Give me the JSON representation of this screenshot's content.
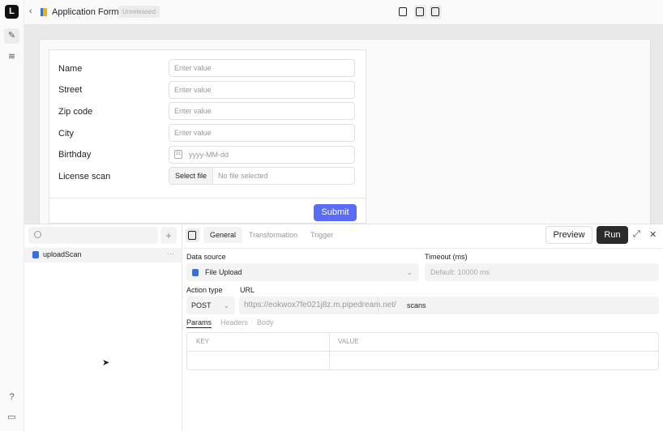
{
  "app": {
    "title": "Application Form",
    "status": "Unreleased"
  },
  "form": {
    "fields": [
      {
        "label": "Name",
        "placeholder": "Enter value"
      },
      {
        "label": "Street",
        "placeholder": "Enter value"
      },
      {
        "label": "Zip code",
        "placeholder": "Enter value"
      },
      {
        "label": "City",
        "placeholder": "Enter value"
      },
      {
        "label": "Birthday",
        "placeholder": "yyyy-MM-dd"
      },
      {
        "label": "License scan",
        "button": "Select file",
        "placeholder": "No file selected"
      }
    ],
    "submit": "Submit",
    "accent": "#5a6cf5"
  },
  "queries": {
    "items": [
      {
        "name": "uploadScan"
      }
    ],
    "more": "···",
    "add": "+"
  },
  "editor": {
    "tabs": [
      "General",
      "Transformation",
      "Trigger"
    ],
    "preview": "Preview",
    "run": "Run",
    "data_source_label": "Data source",
    "data_source": "File Upload",
    "timeout_label": "Timeout (ms)",
    "timeout_placeholder": "Default: 10000 ms",
    "action_type_label": "Action type",
    "action_type": "POST",
    "url_label": "URL",
    "url_base": "https://eokwox7fe021j8z.m.pipedream.net/",
    "url_path": "scans",
    "subtabs": [
      "Params",
      "Headers",
      "Body"
    ],
    "columns": [
      "KEY",
      "VALUE"
    ]
  }
}
